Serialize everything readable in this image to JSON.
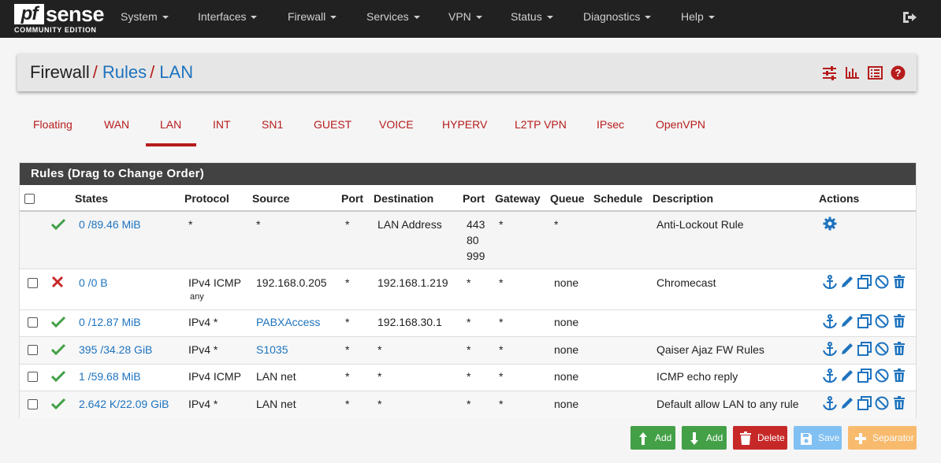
{
  "brand": {
    "logo_pf": "pf",
    "logo_sense": "sense",
    "edition": "COMMUNITY EDITION"
  },
  "nav": {
    "items": [
      {
        "label": "System"
      },
      {
        "label": "Interfaces"
      },
      {
        "label": "Firewall"
      },
      {
        "label": "Services"
      },
      {
        "label": "VPN"
      },
      {
        "label": "Status"
      },
      {
        "label": "Diagnostics"
      },
      {
        "label": "Help"
      }
    ],
    "logout_icon": "logout-icon"
  },
  "breadcrumb": {
    "part1": "Firewall",
    "sep": "/",
    "part2": "Rules",
    "part3": "LAN"
  },
  "header_icons": [
    "settings-sliders-icon",
    "bar-chart-icon",
    "list-icon",
    "help-icon"
  ],
  "tabs": [
    {
      "label": "Floating"
    },
    {
      "label": "WAN"
    },
    {
      "label": "LAN"
    },
    {
      "label": "INT"
    },
    {
      "label": "SN1"
    },
    {
      "label": "GUEST"
    },
    {
      "label": "VOICE"
    },
    {
      "label": "HYPERV"
    },
    {
      "label": "L2TP VPN"
    },
    {
      "label": "IPsec"
    },
    {
      "label": "OpenVPN"
    }
  ],
  "active_tab": "LAN",
  "panel": {
    "title": "Rules (Drag to Change Order)",
    "columns": [
      "States",
      "Protocol",
      "Source",
      "Port",
      "Destination",
      "Port",
      "Gateway",
      "Queue",
      "Schedule",
      "Description",
      "Actions"
    ]
  },
  "rules": [
    {
      "status": "pass",
      "states": "0 /89.46 MiB",
      "protocol": "*",
      "protocol_sub": "",
      "source": "*",
      "source_link": false,
      "sport": "*",
      "destination": "LAN Address",
      "dport": "443",
      "dport2": "80",
      "dport3": "999",
      "gateway": "*",
      "queue": "*",
      "schedule": "",
      "description": "Anti-Lockout Rule"
    },
    {
      "status": "disabled",
      "states": "0 /0 B",
      "protocol": "IPv4 ICMP",
      "protocol_sub": "any",
      "source": "192.168.0.205",
      "source_link": false,
      "sport": "*",
      "destination": "192.168.1.219",
      "dport": "*",
      "gateway": "*",
      "queue": "none",
      "schedule": "",
      "description": "Chromecast"
    },
    {
      "status": "pass",
      "states": "0 /12.87 MiB",
      "protocol": "IPv4 *",
      "protocol_sub": "",
      "source": "PABXAccess",
      "source_link": true,
      "sport": "*",
      "destination": "192.168.30.1",
      "dport": "*",
      "gateway": "*",
      "queue": "none",
      "schedule": "",
      "description": ""
    },
    {
      "status": "pass",
      "states": "395 /34.28 GiB",
      "protocol": "IPv4 *",
      "protocol_sub": "",
      "source": "S1035",
      "source_link": true,
      "sport": "*",
      "destination": "*",
      "dport": "*",
      "gateway": "*",
      "queue": "none",
      "schedule": "",
      "description": "Qaiser Ajaz FW Rules"
    },
    {
      "status": "pass",
      "states": "1 /59.68 MiB",
      "protocol": "IPv4 ICMP",
      "protocol_sub": "",
      "source": "LAN net",
      "source_link": false,
      "sport": "*",
      "destination": "*",
      "dport": "*",
      "gateway": "*",
      "queue": "none",
      "schedule": "",
      "description": "ICMP echo reply"
    },
    {
      "status": "pass",
      "states": "2.642 K/22.09 GiB",
      "protocol": "IPv4 *",
      "protocol_sub": "",
      "source": "LAN net",
      "source_link": false,
      "sport": "*",
      "destination": "*",
      "dport": "*",
      "gateway": "*",
      "queue": "none",
      "schedule": "",
      "description": "Default allow LAN to any rule"
    }
  ],
  "buttons": {
    "add_top": "Add",
    "add_bottom": "Add",
    "delete": "Delete",
    "save": "Save",
    "separator": "Separator"
  },
  "colors": {
    "pass": "#43a047",
    "block": "#c62828",
    "link": "#1e73be",
    "accent": "#b71c1c",
    "highlight": "#ffff00"
  }
}
